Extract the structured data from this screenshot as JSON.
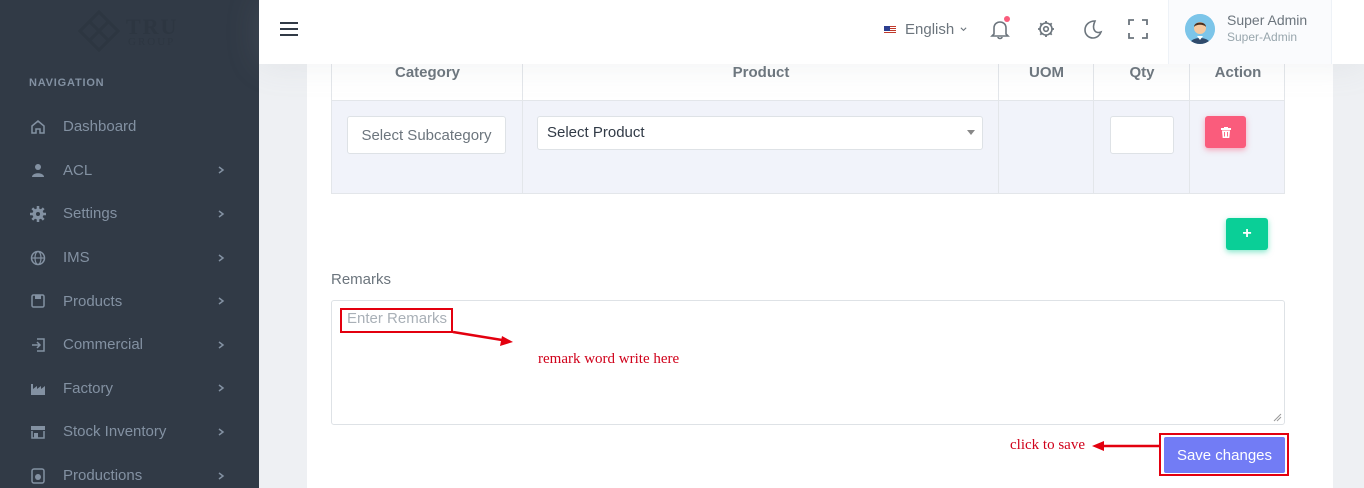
{
  "brand": {
    "name": "TRU",
    "sub": "GROUP"
  },
  "sidebar": {
    "title": "NAVIGATION",
    "items": [
      {
        "label": "Dashboard",
        "icon": "home-icon",
        "has_children": false
      },
      {
        "label": "ACL",
        "icon": "user-icon",
        "has_children": true
      },
      {
        "label": "Settings",
        "icon": "gear-icon",
        "has_children": true
      },
      {
        "label": "IMS",
        "icon": "globe-icon",
        "has_children": true
      },
      {
        "label": "Products",
        "icon": "box-icon",
        "has_children": true
      },
      {
        "label": "Commercial",
        "icon": "login-icon",
        "has_children": true
      },
      {
        "label": "Factory",
        "icon": "factory-icon",
        "has_children": true
      },
      {
        "label": "Stock Inventory",
        "icon": "store-icon",
        "has_children": true
      },
      {
        "label": "Productions",
        "icon": "production-icon",
        "has_children": true
      }
    ]
  },
  "topbar": {
    "language": "English",
    "user_name": "Super Admin",
    "user_role": "Super-Admin",
    "colors": {
      "notification_dot": "#fa5c7c"
    }
  },
  "table": {
    "headers": [
      "Category",
      "Product",
      "UOM",
      "Qty",
      "Action"
    ],
    "row": {
      "category_placeholder": "Select Subcategory",
      "product_placeholder": "Select Product",
      "uom": "",
      "qty": ""
    }
  },
  "form": {
    "add_label": "+",
    "remarks_label": "Remarks",
    "remarks_placeholder": "Enter Remarks",
    "save_label": "Save changes"
  },
  "annotations": {
    "remark_note": "remark word write here",
    "save_note": "click to save"
  },
  "colors": {
    "sidebar_bg": "#313a46",
    "primary": "#727cf5",
    "danger": "#fa5c7c",
    "success": "#0acf97",
    "annotation": "#e3000f"
  }
}
